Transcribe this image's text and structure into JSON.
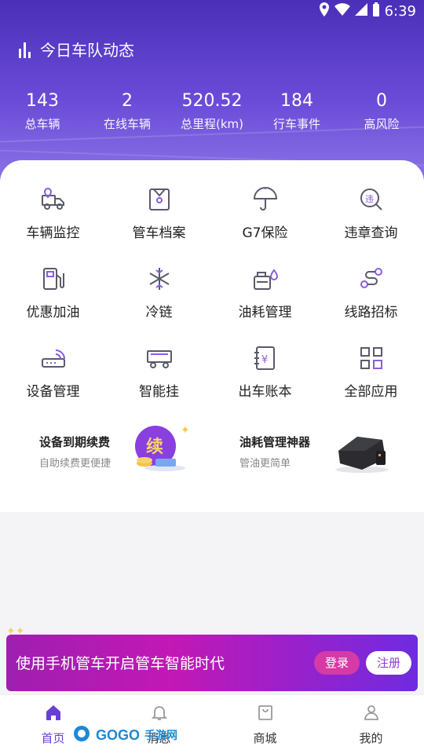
{
  "status": {
    "time": "6:39"
  },
  "header": {
    "title": "今日车队动态"
  },
  "stats": [
    {
      "value": "143",
      "label": "总车辆"
    },
    {
      "value": "2",
      "label": "在线车辆"
    },
    {
      "value": "520.52",
      "label": "总里程(km)"
    },
    {
      "value": "184",
      "label": "行车事件"
    },
    {
      "value": "0",
      "label": "高风险"
    }
  ],
  "apps": [
    {
      "label": "车辆监控",
      "icon": "truck-location-icon"
    },
    {
      "label": "管车档案",
      "icon": "archive-icon"
    },
    {
      "label": "G7保险",
      "icon": "umbrella-icon"
    },
    {
      "label": "违章查询",
      "icon": "violation-search-icon"
    },
    {
      "label": "优惠加油",
      "icon": "fuel-pump-icon"
    },
    {
      "label": "冷链",
      "icon": "snowflake-icon"
    },
    {
      "label": "油耗管理",
      "icon": "oil-drop-icon"
    },
    {
      "label": "线路招标",
      "icon": "route-icon"
    },
    {
      "label": "设备管理",
      "icon": "router-icon"
    },
    {
      "label": "智能挂",
      "icon": "trailer-icon"
    },
    {
      "label": "出车账本",
      "icon": "ledger-icon"
    },
    {
      "label": "全部应用",
      "icon": "grid-icon"
    }
  ],
  "promos": [
    {
      "title": "设备到期续费",
      "subtitle": "自助续费更便捷",
      "badge": "续"
    },
    {
      "title": "油耗管理神器",
      "subtitle": "管油更简单"
    }
  ],
  "banner": {
    "text": "使用手机管车开启管车智能时代",
    "login": "登录",
    "register": "注册"
  },
  "tabs": [
    {
      "label": "首页"
    },
    {
      "label": "消息"
    },
    {
      "label": "商城"
    },
    {
      "label": "我的"
    }
  ],
  "watermark": {
    "brand": "GOGO",
    "suffix": "手游网"
  },
  "colors": {
    "primary": "#6a3fd6",
    "hero": "#5b3fc9",
    "banner": "#c218b4"
  }
}
